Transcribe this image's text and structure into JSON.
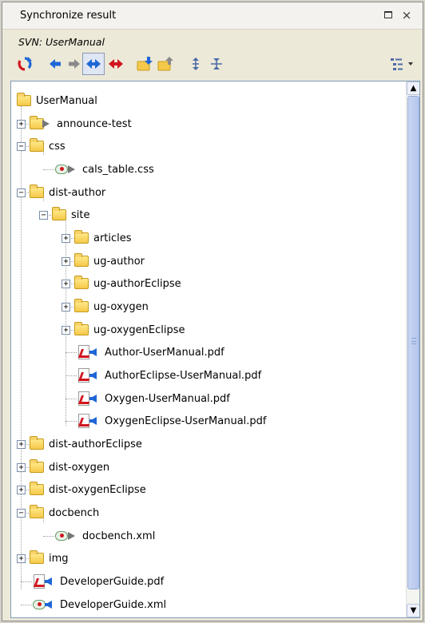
{
  "window": {
    "title": "Synchronize result",
    "subtitle": "SVN: UserManual",
    "maximize_icon": "maximize-icon",
    "close_icon": "close-icon"
  },
  "toolbar": {
    "buttons": [
      {
        "name": "refresh-button",
        "icon": "refresh-icon"
      },
      {
        "name": "incoming-mode-button",
        "icon": "arrow-left-icon"
      },
      {
        "name": "outgoing-mode-button",
        "icon": "arrow-right-icon"
      },
      {
        "name": "incoming-outgoing-mode-button",
        "icon": "arrow-both-blue-icon",
        "pressed": true
      },
      {
        "name": "conflicts-mode-button",
        "icon": "arrow-both-red-icon"
      },
      {
        "name": "update-all-button",
        "icon": "folder-update-icon"
      },
      {
        "name": "commit-all-button",
        "icon": "folder-commit-icon"
      },
      {
        "name": "expand-all-button",
        "icon": "expand-all-icon"
      },
      {
        "name": "collapse-all-button",
        "icon": "collapse-all-icon"
      },
      {
        "name": "view-menu-button",
        "icon": "tree-view-menu-icon"
      }
    ]
  },
  "tree": {
    "items": [
      {
        "label": "UserManual",
        "type": "folder",
        "status": "none"
      },
      {
        "label": "announce-test",
        "type": "folder",
        "status": "outgoing"
      },
      {
        "label": "css",
        "type": "folder",
        "status": "none"
      },
      {
        "label": "cals_table.css",
        "type": "xml",
        "status": "outgoing"
      },
      {
        "label": "dist-author",
        "type": "folder",
        "status": "none"
      },
      {
        "label": "site",
        "type": "folder",
        "status": "none"
      },
      {
        "label": "articles",
        "type": "folder",
        "status": "none"
      },
      {
        "label": "ug-author",
        "type": "folder",
        "status": "none"
      },
      {
        "label": "ug-authorEclipse",
        "type": "folder",
        "status": "none"
      },
      {
        "label": "ug-oxygen",
        "type": "folder",
        "status": "none"
      },
      {
        "label": "ug-oxygenEclipse",
        "type": "folder",
        "status": "none"
      },
      {
        "label": "Author-UserManual.pdf",
        "type": "pdf",
        "status": "incoming"
      },
      {
        "label": "AuthorEclipse-UserManual.pdf",
        "type": "pdf",
        "status": "incoming"
      },
      {
        "label": "Oxygen-UserManual.pdf",
        "type": "pdf",
        "status": "incoming"
      },
      {
        "label": "OxygenEclipse-UserManual.pdf",
        "type": "pdf",
        "status": "incoming"
      },
      {
        "label": "dist-authorEclipse",
        "type": "folder",
        "status": "none"
      },
      {
        "label": "dist-oxygen",
        "type": "folder",
        "status": "none"
      },
      {
        "label": "dist-oxygenEclipse",
        "type": "folder",
        "status": "none"
      },
      {
        "label": "docbench",
        "type": "folder",
        "status": "none"
      },
      {
        "label": "docbench.xml",
        "type": "xml",
        "status": "outgoing"
      },
      {
        "label": "img",
        "type": "folder",
        "status": "none"
      },
      {
        "label": "DeveloperGuide.pdf",
        "type": "pdf",
        "status": "incoming"
      },
      {
        "label": "DeveloperGuide.xml",
        "type": "xml",
        "status": "incoming"
      }
    ]
  },
  "colors": {
    "incoming_arrow": "#1f66d6",
    "outgoing_arrow": "#777777",
    "conflict_arrow": "#d2161f",
    "folder": "#f5c94a"
  }
}
